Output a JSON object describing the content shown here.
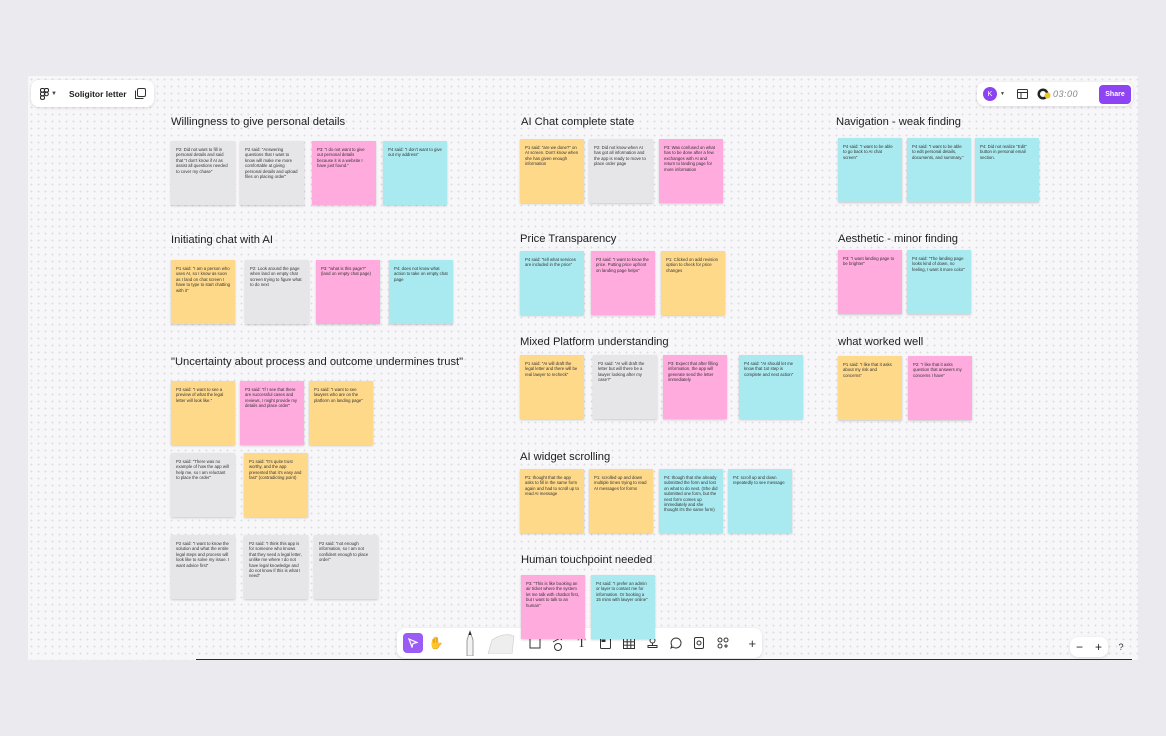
{
  "header": {
    "title": "Soligitor letter",
    "avatar_letter": "K",
    "timer": "03:00",
    "share_label": "Share"
  },
  "sections": [
    {
      "title": "Willingness to give personal details",
      "notes": [
        {
          "color": "gray",
          "text": "P2: Did not want to fill in personal details and said that \"I don't know if AI as assist all questions needed to cover my chase\""
        },
        {
          "color": "gray",
          "text": "P2 said: \"Answering questions that I want to know will make me more comfortable at giving personal details and upload files on placing order\""
        },
        {
          "color": "pink",
          "text": "P3: \"I do not want to give out personal details because it is a website I have just found.\""
        },
        {
          "color": "cyan",
          "text": "P4 said: \"I don't want to give out my address\""
        }
      ]
    },
    {
      "title": "Initiating chat with AI",
      "notes": [
        {
          "color": "yellow",
          "text": "P1 said: \"I am a person who uses AI, so I know as soon as I land on chat screen I have to type to start chatting with it\""
        },
        {
          "color": "gray",
          "text": "P2: Look around the page when land on empty chat screen trying to figure what to do next"
        },
        {
          "color": "pink",
          "text": "P3: \"what is this page?\" (land on empty chat page)"
        },
        {
          "color": "cyan",
          "text": "P4: does not know what action to take on empty chat page"
        }
      ]
    },
    {
      "title": "\"Uncertainty about process and outcome undermines trust\"",
      "notes": [
        {
          "color": "yellow",
          "text": "P3 said: \"I want to see a preview of what the legal letter will look like.\""
        },
        {
          "color": "pink",
          "text": "P3 said: \"If I see that there are successful cases and reviews, I might provide my details and place order\""
        },
        {
          "color": "yellow",
          "text": "P1 said: \"I want to see lawyers who are on the platform on landing page\""
        },
        {
          "color": "gray",
          "text": "P2 said: \"There was no example of how the app will help me, so I am reluctant to place the order\""
        },
        {
          "color": "yellow",
          "text": "P1 said: \"It's quite trust worthy, and the app presented that it's easy and fast\" (contradicting point)"
        },
        {
          "color": "gray",
          "text": "P2 said: \"I want to know the solution and what the entire legal steps and process will look like to solve my issue. I want advice first\""
        },
        {
          "color": "gray",
          "text": "P2 said: \"I think this app is for someone who knows that they need a legal letter, unlike me where I do not have legal knowledge and do not know if this is what I need\""
        },
        {
          "color": "gray",
          "text": "P2 said: \"not enough information, so I am not confident enough to place order\""
        }
      ]
    },
    {
      "title": "AI Chat complete state",
      "notes": [
        {
          "color": "yellow",
          "text": "P1 said: \"are we done?\" on AI screen. Don't know when she has given enough information"
        },
        {
          "color": "gray",
          "text": "P2: Did not know when AI has got all information and the app is ready to move to place order page"
        },
        {
          "color": "pink",
          "text": "P3: Was confused on what has to be done after a few exchanges with AI and return to landing page for more information"
        }
      ]
    },
    {
      "title": "Price Transparency",
      "notes": [
        {
          "color": "cyan",
          "text": "P4 said: \"tell what services are included in the price\""
        },
        {
          "color": "pink",
          "text": "P3 said: \"I want to know the price. Putting price upfront on landing page helps\""
        },
        {
          "color": "yellow",
          "text": "P1: Clicked on add revision option to check for price changes"
        }
      ]
    },
    {
      "title": "Mixed Platform understanding",
      "notes": [
        {
          "color": "yellow",
          "text": "P1 said: \"AI will draft the legal letter and there will be real lawyer to recheck\""
        },
        {
          "color": "gray",
          "text": "P2 said: \"AI will draft the letter but will there be a lawyer looking after my case?\""
        },
        {
          "color": "pink",
          "text": "P3: Expect that after filling information, the app will generate send the letter immediately"
        },
        {
          "color": "cyan",
          "text": "P4 said: \"AI should let me know that 1st step is complete and next action\""
        }
      ]
    },
    {
      "title": "AI widget scrolling",
      "notes": [
        {
          "color": "yellow",
          "text": "P1: thought that the app asks to fill in the same form again and had to scroll up to read AI message"
        },
        {
          "color": "yellow",
          "text": "P1: scrolled up and down multiple times trying to read AI messages for forms"
        },
        {
          "color": "cyan",
          "text": "P4: though that she already submitted the form and lost on what to do next. (She did submitted one form, but the next form comes up immediately and she thought it's the same form)"
        },
        {
          "color": "cyan",
          "text": "P4: scroll up and down repeatedly to see message"
        }
      ]
    },
    {
      "title": "Human touchpoint needed",
      "notes": [
        {
          "color": "pink",
          "text": "P3: \"This is like booking an air ticket where the system let me talk with chatbot first, but I want to talk to an human\""
        },
        {
          "color": "cyan",
          "text": "P4 said: \"I prefer an admin or layer to contact me for information. Or booking a 15 mins with lawyer online\""
        }
      ]
    },
    {
      "title": "Navigation - weak finding",
      "notes": [
        {
          "color": "cyan",
          "text": "P4 said: \"I want to be able to go back to AI chat screen\""
        },
        {
          "color": "cyan",
          "text": "P4 said: \"I want to be able to edit personal details, documents, and summary.\""
        },
        {
          "color": "cyan",
          "text": "P4: Did not realize \"Edit\" button in personal email section."
        }
      ]
    },
    {
      "title": "Aesthetic - minor finding",
      "notes": [
        {
          "color": "pink",
          "text": "P3: \"I want landing page to be brighter\""
        },
        {
          "color": "cyan",
          "text": "P4 said: \"The landing page looks kind of down, no feeling, I want it more color\""
        }
      ]
    },
    {
      "title": "what worked well",
      "notes": [
        {
          "color": "yellow",
          "text": "P1 said: \"I like that it asks about my risk and concerns\""
        },
        {
          "color": "pink",
          "text": "P2: \"I like that it asks question that answers my concerns I have\""
        }
      ]
    }
  ]
}
